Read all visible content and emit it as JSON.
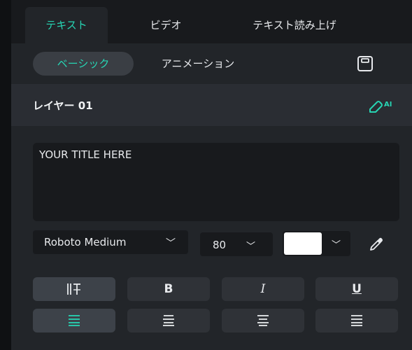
{
  "tabs": [
    {
      "label": "テキスト",
      "active": true
    },
    {
      "label": "ビデオ",
      "active": false
    },
    {
      "label": "テキスト読み上げ",
      "active": false
    }
  ],
  "subtabs": [
    {
      "label": "ベーシック",
      "active": true
    },
    {
      "label": "アニメーション",
      "active": false
    }
  ],
  "icons": {
    "save": "save-icon",
    "ai_edit": "ai-eraser-icon",
    "eyedropper": "eyedropper-icon"
  },
  "layer": {
    "title": "レイヤー 01",
    "ai_label": "AI"
  },
  "text_input": {
    "value": "YOUR TITLE HERE"
  },
  "font": {
    "family": "Roboto Medium",
    "size": "80",
    "color": "#ffffff"
  },
  "style_buttons": {
    "bold": "B",
    "italic": "I",
    "underline": "U"
  },
  "accent_color": "#27d4b3"
}
